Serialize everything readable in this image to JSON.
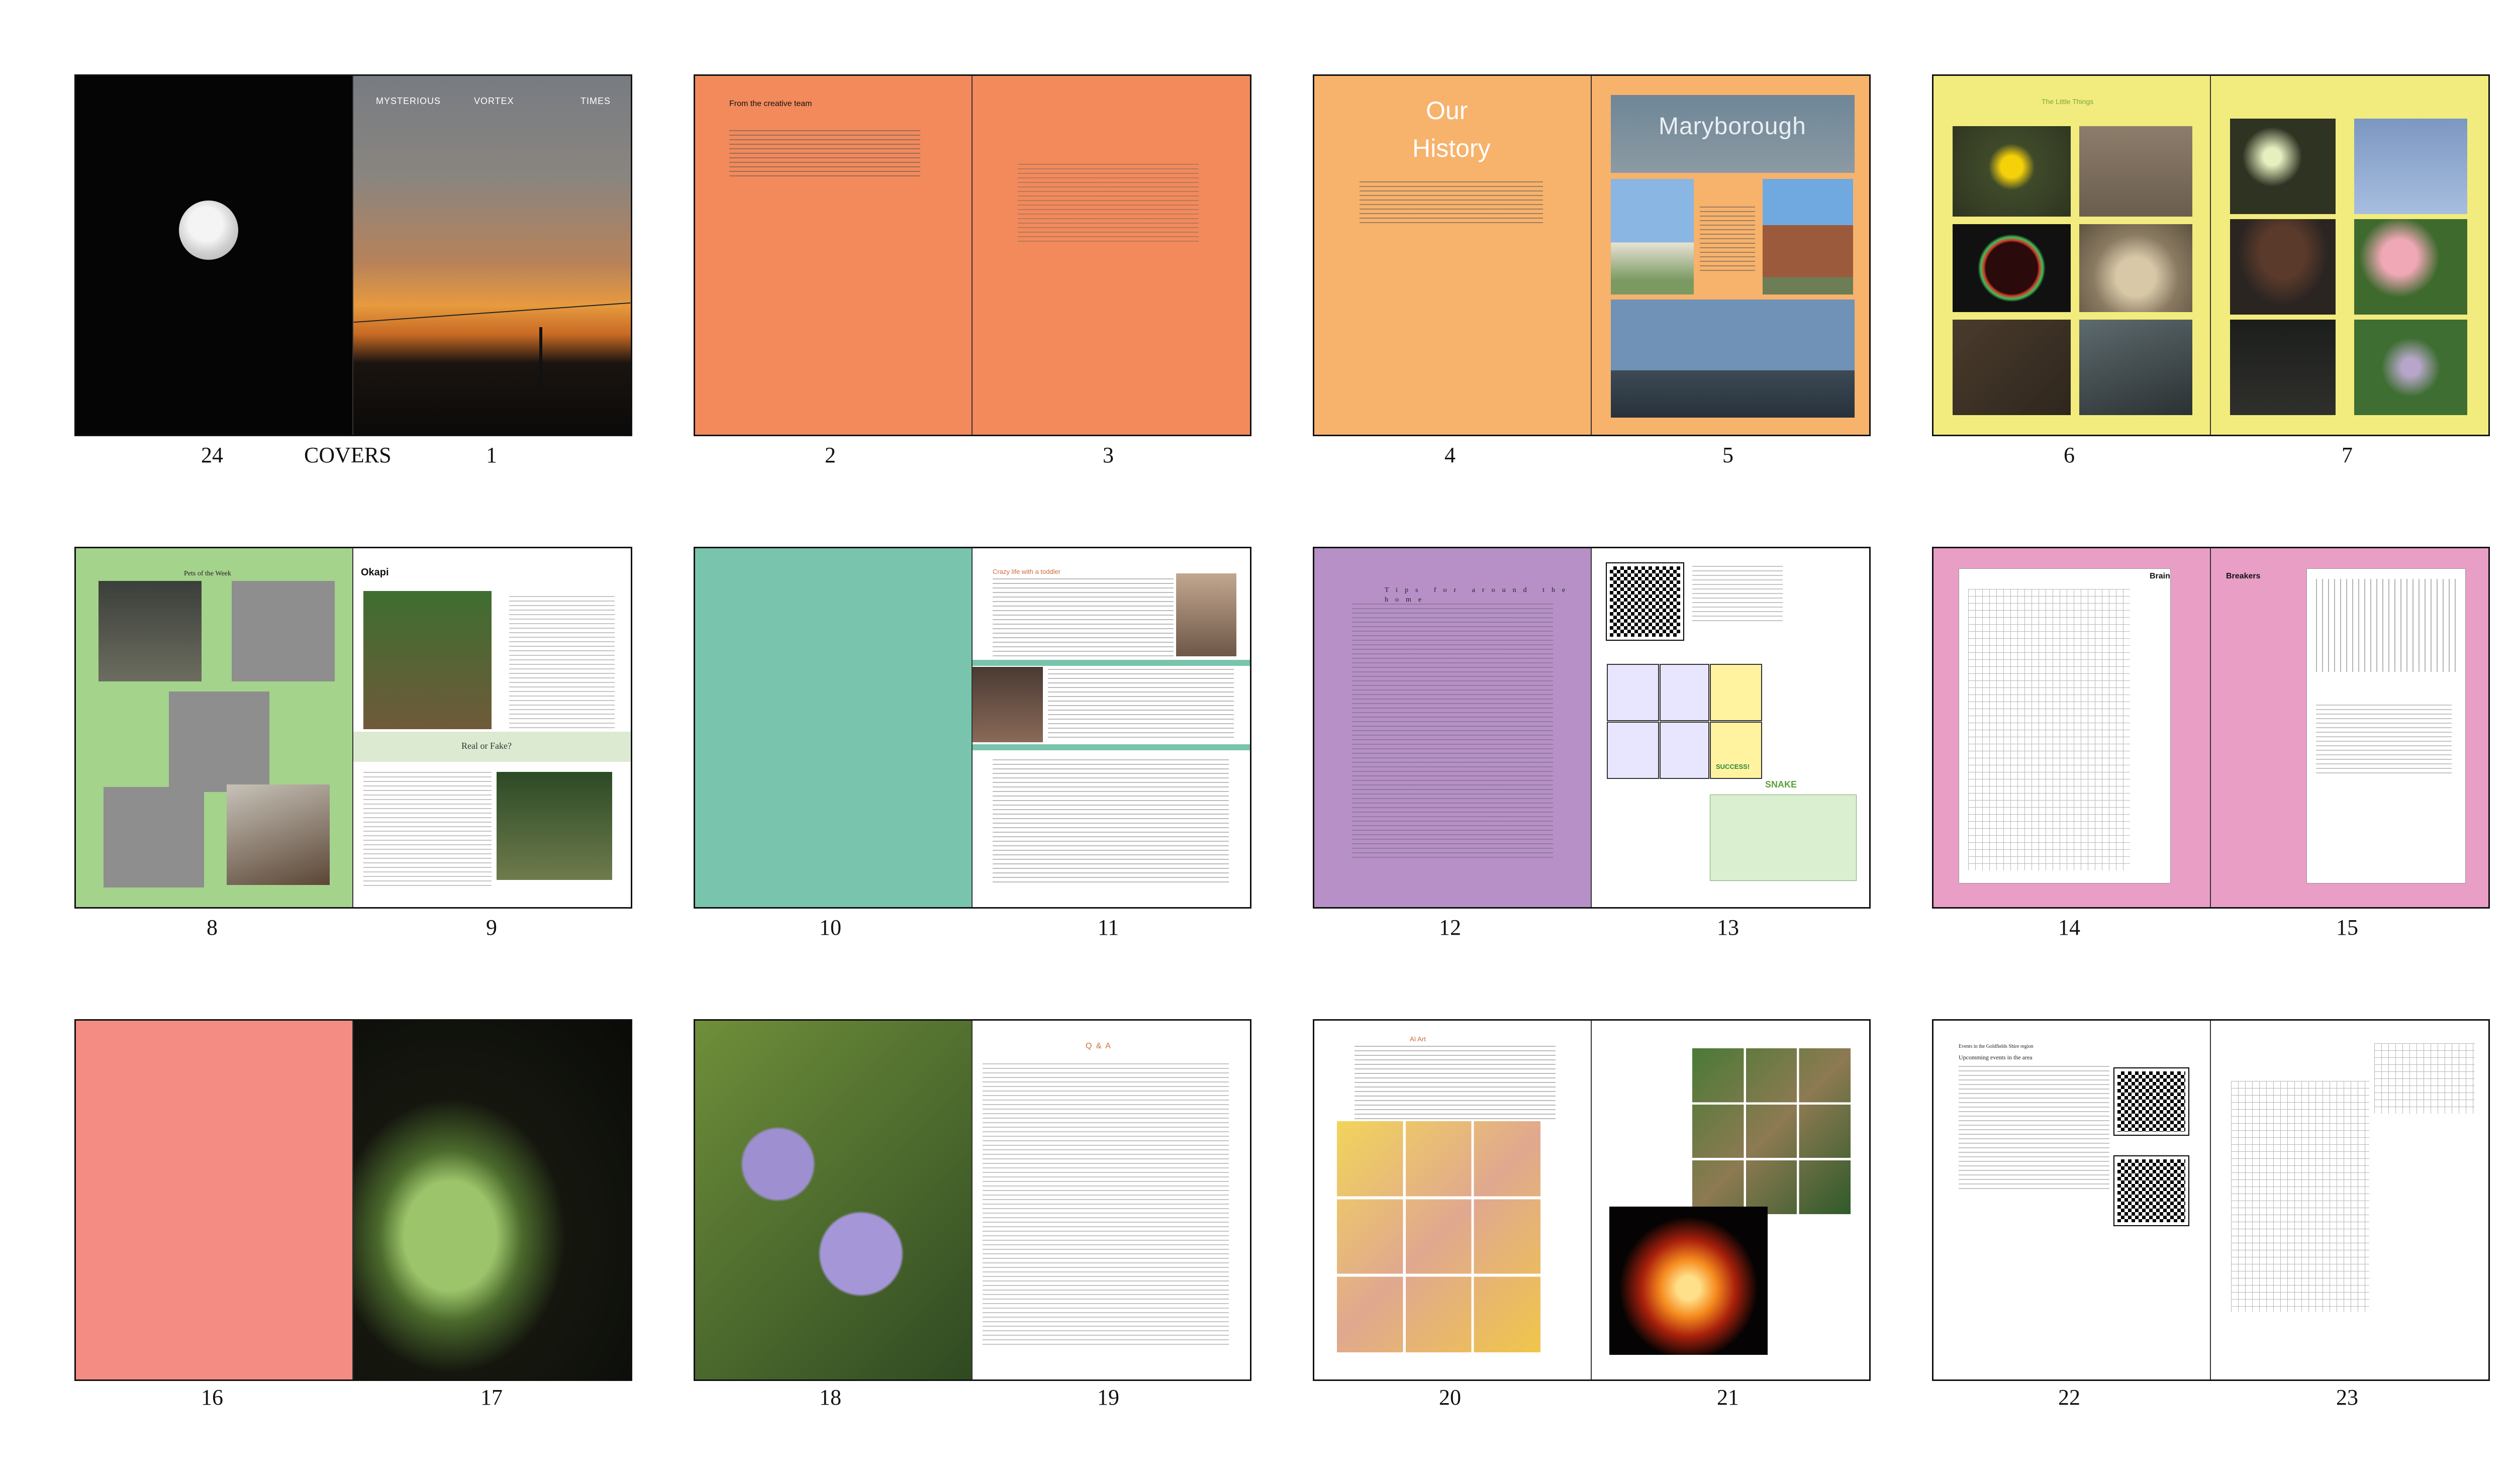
{
  "colors": {
    "orange": "#f28a5c",
    "peach": "#f7b26c",
    "yellow": "#f2ec7e",
    "green": "#a4d38c",
    "teal": "#79c4ad",
    "purple": "#b690c6",
    "pink": "#e89ec5",
    "salmon": "#f48c84"
  },
  "labels": {
    "covers": "COVERS",
    "n24": "24",
    "n1": "1",
    "n2": "2",
    "n3": "3",
    "n4": "4",
    "n5": "5",
    "n6": "6",
    "n7": "7",
    "n8": "8",
    "n9": "9",
    "n10": "10",
    "n11": "11",
    "n12": "12",
    "n13": "13",
    "n14": "14",
    "n15": "15",
    "n16": "16",
    "n17": "17",
    "n18": "18",
    "n19": "19",
    "n20": "20",
    "n21": "21",
    "n22": "22",
    "n23": "23"
  },
  "cover": {
    "word1": "MYSTERIOUS",
    "word2": "VORTEX",
    "word3": "TIMES"
  },
  "p2": {
    "heading": "From the creative team"
  },
  "p4": {
    "title_line1": "Our",
    "title_line2": "History"
  },
  "p5": {
    "sign": "Maryborough"
  },
  "p6": {
    "heading": "The Little Things"
  },
  "p8": {
    "heading": "Pets of the Week"
  },
  "p9": {
    "heading": "Okapi",
    "band": "Real or Fake?"
  },
  "p11": {
    "heading": "Crazy life with a toddler"
  },
  "p12": {
    "heading": "Tips for around the home"
  },
  "p13": {
    "snake_caption": "SNAKE",
    "success": "SUCCESS!"
  },
  "p14": {
    "heading": "Brain"
  },
  "p15": {
    "heading": "Breakers"
  },
  "p19": {
    "heading": "Q & A"
  },
  "p20": {
    "heading": "AI Art"
  },
  "p22": {
    "heading": "Events in the Goldfields Shire region",
    "subheading": "Upcomming events in the area"
  }
}
